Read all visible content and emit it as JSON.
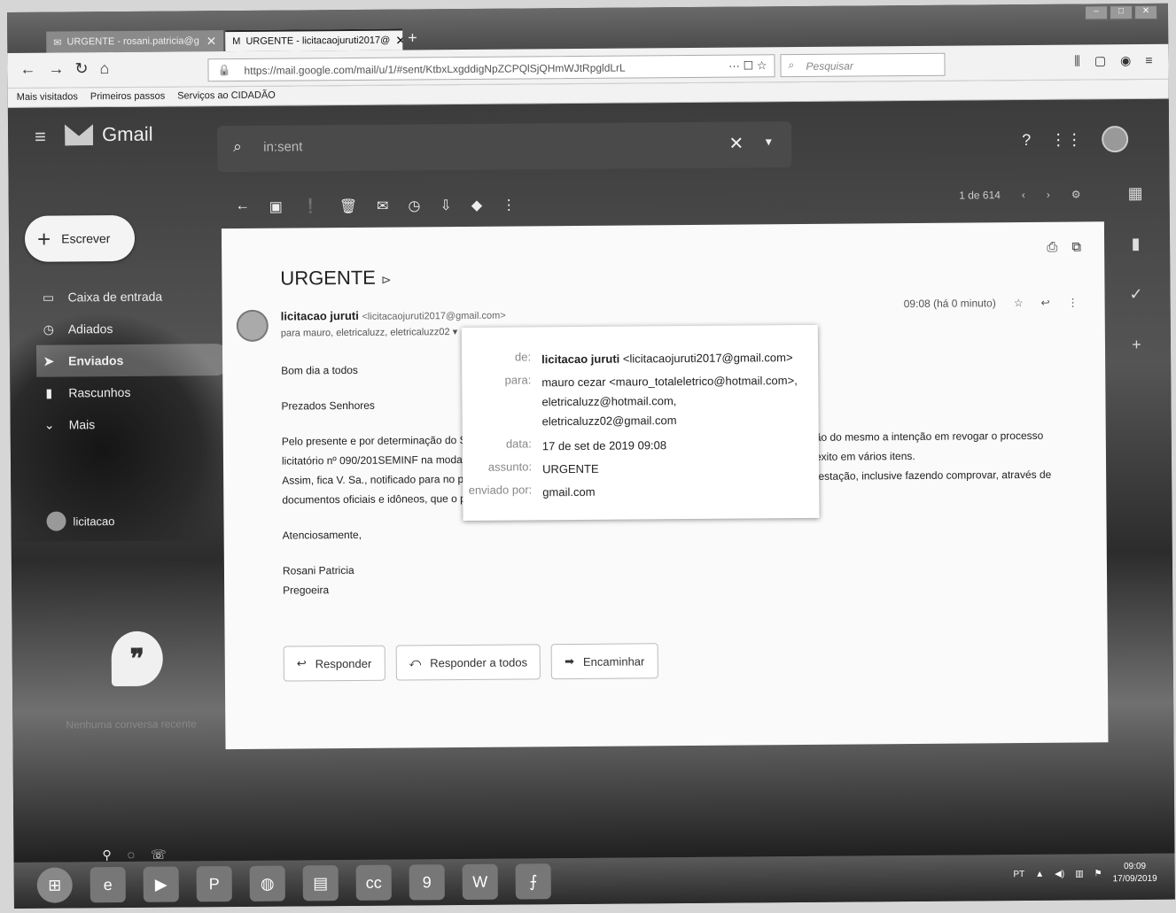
{
  "browser": {
    "tabs": [
      {
        "label": "URGENTE - rosani.patricia@g"
      },
      {
        "label": "URGENTE - licitacaojuruti2017@"
      }
    ],
    "url": "https://mail.google.com/mail/u/1/#sent/KtbxLxgddigNpZCPQlSjQHmWJtRpgldLrL",
    "search_placeholder": "Pesquisar",
    "bookmarks": [
      "Mais visitados",
      "Primeiros passos",
      "Serviços ao CIDADÃO"
    ]
  },
  "gmail": {
    "app_name": "Gmail",
    "search_value": "in:sent",
    "compose_label": "Escrever",
    "sidebar": [
      {
        "label": "Caixa de entrada",
        "icon": "inbox-icon"
      },
      {
        "label": "Adiados",
        "icon": "clock-icon"
      },
      {
        "label": "Enviados",
        "icon": "send-icon",
        "active": true
      },
      {
        "label": "Rascunhos",
        "icon": "draft-icon"
      },
      {
        "label": "Mais",
        "icon": "chevron-down-icon"
      }
    ],
    "account_label": "licitacao",
    "hangouts_text": "Nenhuma conversa recente",
    "pager": "1 de 614"
  },
  "message": {
    "subject": "URGENTE",
    "sender_name": "licitacao juruti",
    "sender_email": "<licitacaojuruti2017@gmail.com>",
    "to_line": "para mauro, eletricaluzz, eletricaluzz02",
    "time": "09:08 (há 0 minuto)",
    "body": [
      "Bom dia a todos",
      "Prezados Senhores",
      "Pelo presente e por determinação do S",
      "licitatório nº 090/201SEMINF  na moda",
      "Assim, fica V. Sa., notificado para no p",
      "documentos oficiais e idôneos, que o p",
      "Atenciosamente,",
      "Rosani Patricia",
      "Pregoeira"
    ],
    "body_right": [
      "ão do mesmo a intenção em revogar o processo",
      "exito em vários itens.",
      "festação, inclusive fazendo comprovar, através de"
    ],
    "details": {
      "de_label": "de:",
      "de_value_name": "licitacao juruti",
      "de_value_email": "<licitacaojuruti2017@gmail.com>",
      "para_label": "para:",
      "para_value_1": "mauro cezar <mauro_totaleletrico@hotmail.com>,",
      "para_value_2": "eletricaluzz@hotmail.com,",
      "para_value_3": "eletricaluzz02@gmail.com",
      "data_label": "data:",
      "data_value": "17 de set de 2019 09:08",
      "assunto_label": "assunto:",
      "assunto_value": "URGENTE",
      "enviado_label": "enviado por:",
      "enviado_value": "gmail.com"
    },
    "buttons": [
      "Responder",
      "Responder a todos",
      "Encaminhar"
    ]
  },
  "taskbar": {
    "lang": "PT",
    "time": "09:09",
    "date": "17/09/2019"
  }
}
